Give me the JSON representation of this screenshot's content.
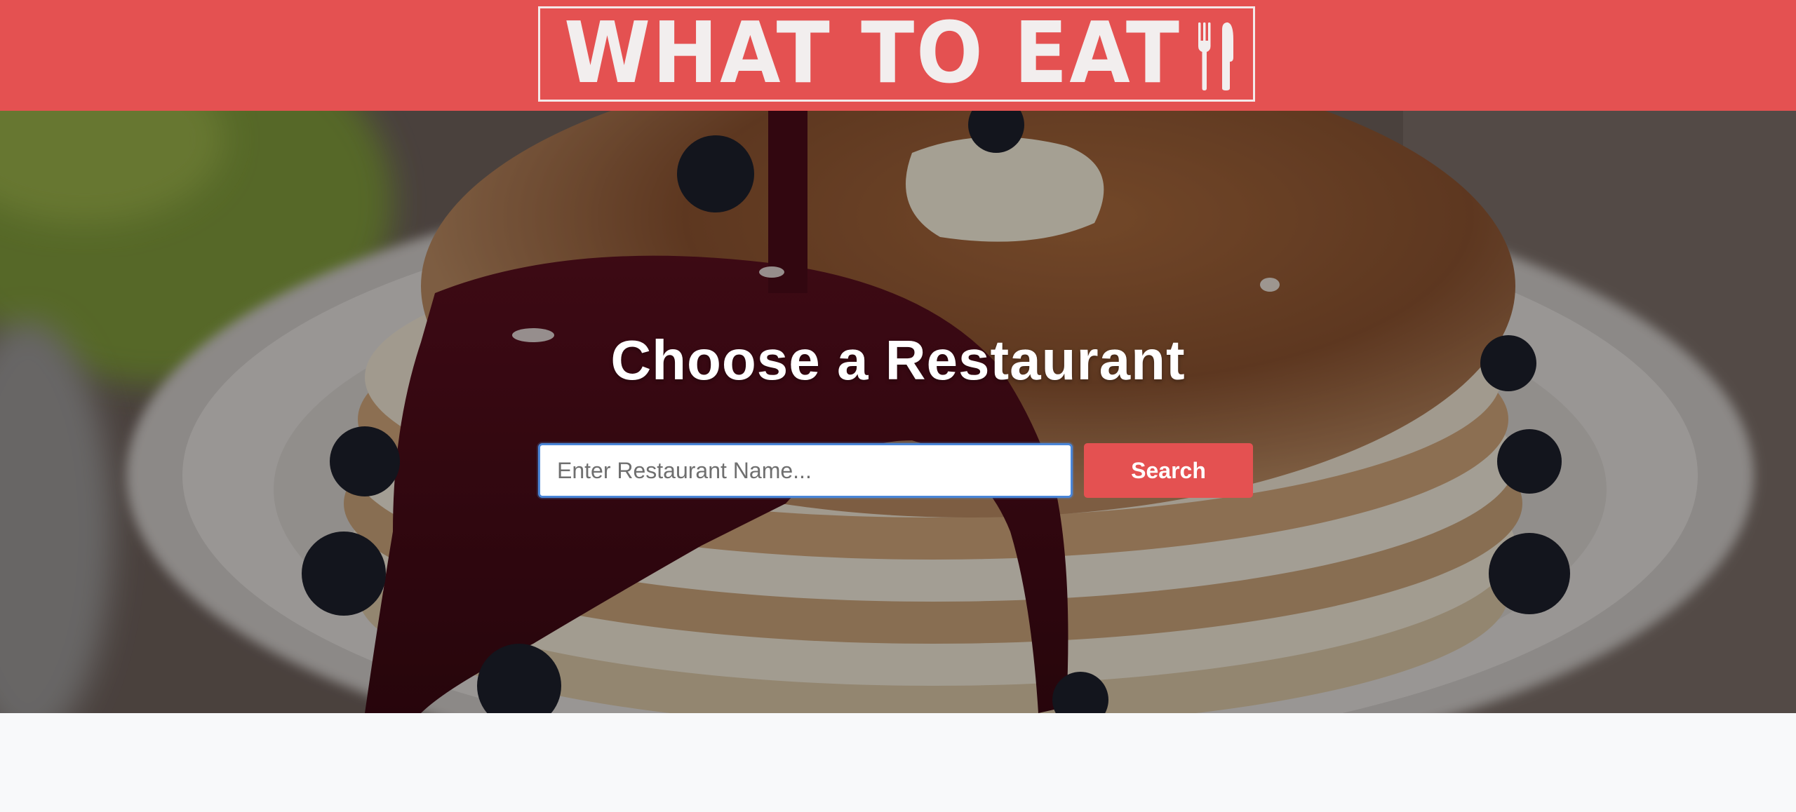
{
  "header": {
    "logo_text": "WHAT TO EAT",
    "logo_icon": "fork-knife-icon",
    "background_color": "#e45151"
  },
  "hero": {
    "title": "Choose a Restaurant",
    "background_image": "pancakes-with-berry-syrup"
  },
  "search": {
    "placeholder": "Enter Restaurant Name...",
    "value": "",
    "button_label": "Search",
    "button_color": "#e45151",
    "focus_border_color": "#4a86d8"
  }
}
